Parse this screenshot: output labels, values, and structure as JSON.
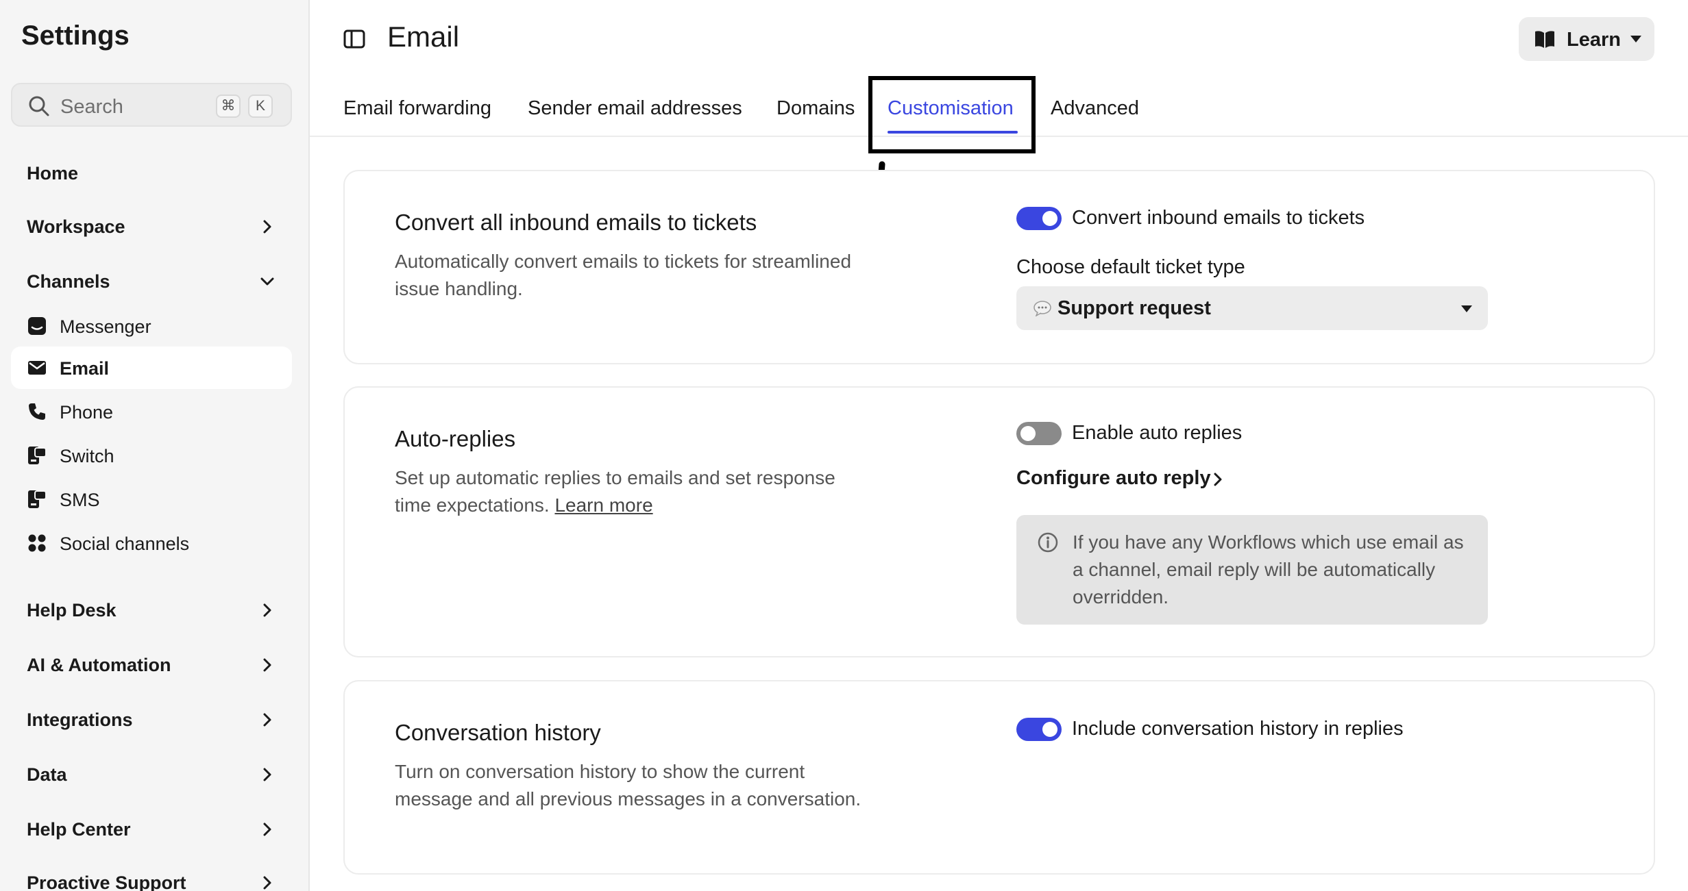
{
  "sidebar": {
    "title": "Settings",
    "search": {
      "label": "Search",
      "shortcut_keys": [
        "⌘",
        "K"
      ]
    },
    "top_items": [
      {
        "label": "Home",
        "has_chevron": false
      },
      {
        "label": "Workspace",
        "has_chevron": true,
        "chevron": "right"
      },
      {
        "label": "Channels",
        "has_chevron": true,
        "chevron": "down"
      },
      {
        "label": "Help Desk",
        "has_chevron": true,
        "chevron": "right"
      },
      {
        "label": "AI & Automation",
        "has_chevron": true,
        "chevron": "right"
      },
      {
        "label": "Integrations",
        "has_chevron": true,
        "chevron": "right"
      },
      {
        "label": "Data",
        "has_chevron": true,
        "chevron": "right"
      },
      {
        "label": "Help Center",
        "has_chevron": true,
        "chevron": "right"
      },
      {
        "label": "Proactive Support",
        "has_chevron": true,
        "chevron": "right"
      }
    ],
    "channel_items": [
      {
        "label": "Messenger",
        "icon": "messenger-icon"
      },
      {
        "label": "Email",
        "icon": "envelope-icon",
        "active": true
      },
      {
        "label": "Phone",
        "icon": "phone-icon"
      },
      {
        "label": "Switch",
        "icon": "switch-icon"
      },
      {
        "label": "SMS",
        "icon": "sms-icon"
      },
      {
        "label": "Social channels",
        "icon": "grid-icon"
      }
    ]
  },
  "header": {
    "title": "Email",
    "panel_icon": "sidebar-toggle-icon",
    "learn_button": {
      "label": "Learn",
      "icon": "book-icon"
    }
  },
  "tabs": [
    {
      "label": "Email forwarding"
    },
    {
      "label": "Sender email addresses"
    },
    {
      "label": "Domains"
    },
    {
      "label": "Customisation",
      "active": true
    },
    {
      "label": "Advanced"
    }
  ],
  "cards": {
    "convert": {
      "title": "Convert all inbound emails to tickets",
      "description": "Automatically convert emails to tickets for streamlined issue handling.",
      "toggle": {
        "label": "Convert inbound emails to tickets",
        "on": true
      },
      "ticket_type_label": "Choose default ticket type",
      "ticket_type_value": "Support request",
      "ticket_type_icon": "speech-bubble-icon"
    },
    "auto_replies": {
      "title": "Auto-replies",
      "description": "Set up automatic replies to emails and set response time expectations.",
      "learn_more": "Learn more",
      "toggle": {
        "label": "Enable auto replies",
        "on": false
      },
      "configure_link": "Configure auto reply",
      "note": "If you have any Workflows which use email as a channel, email reply will be automatically overridden."
    },
    "history": {
      "title": "Conversation history",
      "description": "Turn on conversation history to show the current message and all previous messages in a conversation.",
      "toggle": {
        "label": "Include conversation history in replies",
        "on": true
      }
    }
  },
  "colors": {
    "accent": "#3a46e0",
    "sidebar_bg": "#f5f5f5",
    "toggle_off": "#8a8a8a",
    "note_bg": "#e4e4e4"
  }
}
